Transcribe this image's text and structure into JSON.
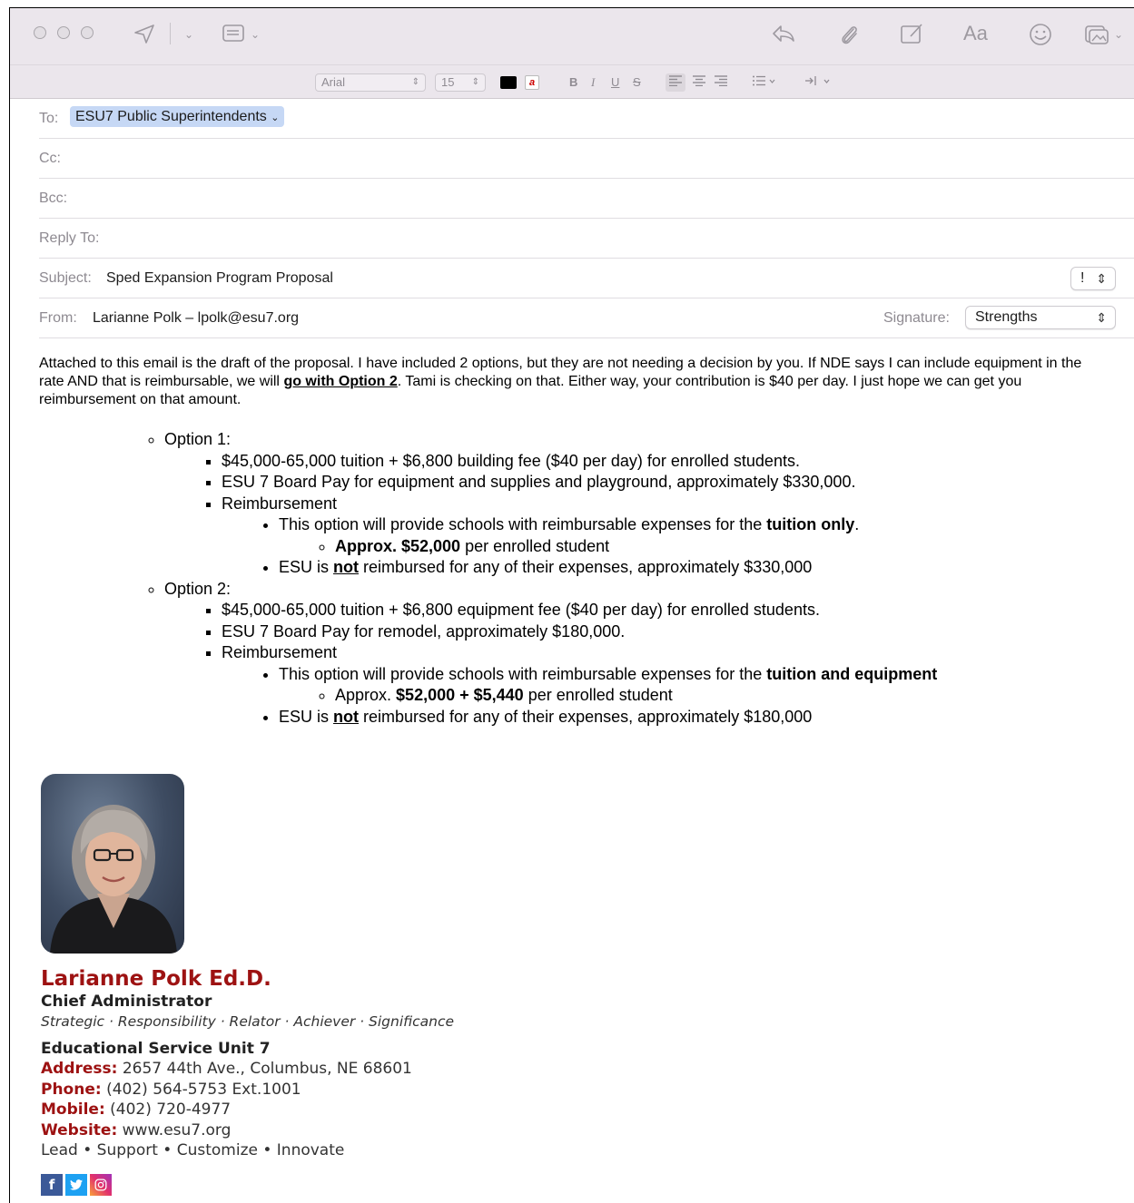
{
  "toolbar": {
    "icons": [
      "send-icon",
      "header-fields-icon",
      "reply-icon",
      "attachment-icon",
      "markup-icon",
      "format-icon",
      "emoji-icon",
      "photo-browser-icon"
    ],
    "format_label": "Aa"
  },
  "format_bar": {
    "font": "Arial",
    "size": "15",
    "bold": "B",
    "italic": "I",
    "underline": "U",
    "strike": "S",
    "text_color": "#000000"
  },
  "header": {
    "to_label": "To:",
    "to_recipient": "ESU7 Public Superintendents",
    "cc_label": "Cc:",
    "bcc_label": "Bcc:",
    "reply_to_label": "Reply To:",
    "subject_label": "Subject:",
    "subject": "Sped Expansion Program Proposal",
    "priority": "!",
    "from_label": "From:",
    "from": "Larianne Polk – lpolk@esu7.org",
    "signature_label": "Signature:",
    "signature": "Strengths"
  },
  "message": {
    "intro_a": "Attached to this email is the draft of the proposal. I have included 2 options, but they are not needing a decision by you. If NDE says I can include equipment in the rate AND that is reimbursable, we will ",
    "intro_bold": "go with Option 2",
    "intro_b": ". Tami is checking on that. Either way, your contribution is $40 per day. I just hope we can get you reimbursement on that amount.",
    "opt1": {
      "label": "Option 1:",
      "tuition": "$45,000-65,000 tuition + $6,800 building fee ($40 per day) for enrolled students.",
      "board": "ESU 7 Board Pay for equipment and supplies and playground, approximately $330,000.",
      "reimb": "Reimbursement",
      "provide_a": "This option will provide schools with reimbursable expenses for the ",
      "provide_bold": "tuition only",
      "provide_b": ".",
      "approx_bold": "Approx. $52,000",
      "approx_rest": " per enrolled student",
      "esu_a": "ESU is ",
      "esu_not": "not",
      "esu_b": " reimbursed for any of their expenses, approximately $330,000"
    },
    "opt2": {
      "label": "Option 2:",
      "tuition": "$45,000-65,000 tuition + $6,800 equipment fee ($40 per day) for enrolled students.",
      "board": "ESU 7 Board Pay for remodel, approximately $180,000.",
      "reimb": "Reimbursement",
      "provide_a": "This option will provide schools with reimbursable expenses for the ",
      "provide_bold": "tuition and equipment",
      "approx_a": "Approx. ",
      "approx_bold": "$52,000 + $5,440",
      "approx_rest": " per enrolled student",
      "esu_a": "ESU is ",
      "esu_not": "not",
      "esu_b": " reimbursed for any of their expenses, approximately $180,000"
    }
  },
  "signature_block": {
    "name": "Larianne Polk Ed.D.",
    "title": "Chief Administrator",
    "strengths": "Strategic · Responsibility · Relator · Achiever · Significance",
    "org": "Educational Service Unit 7",
    "address_label": "Address:",
    "address": " 2657 44th Ave., Columbus, NE 68601",
    "phone_label": "Phone:",
    "phone": " (402) 564-5753 Ext.1001",
    "mobile_label": "Mobile:",
    "mobile": " (402) 720-4977",
    "website_label": "Website:",
    "website": " www.esu7.org",
    "motto": "Lead • Support • Customize • Innovate",
    "brand_color": "#9d1212",
    "social": [
      {
        "name": "facebook-icon",
        "glyph": "f",
        "color": "#3b5998"
      },
      {
        "name": "twitter-icon",
        "glyph": "t",
        "color": "#1da1f2"
      },
      {
        "name": "instagram-icon",
        "glyph": "◎",
        "color": "#d6249f"
      }
    ]
  }
}
